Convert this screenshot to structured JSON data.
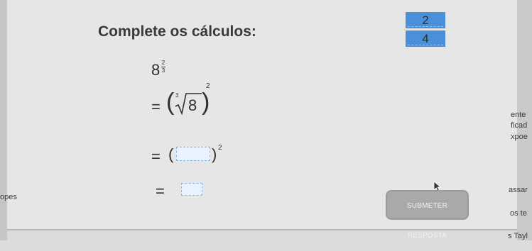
{
  "question": {
    "title": "Complete os cálculos:"
  },
  "answer_options": [
    "2",
    "4"
  ],
  "math": {
    "base": "8",
    "exp_num": "2",
    "exp_den": "3",
    "equals": "=",
    "radicand": "8",
    "root_index": "3",
    "outer_exponent": "2",
    "blank_exponent": "2"
  },
  "buttons": {
    "submit": "SUBMETER RESPOSTA"
  },
  "side_fragments": {
    "right": [
      "ente",
      "ficad",
      "xpoe",
      "assar",
      "os te",
      "s Tayl"
    ],
    "left": [
      "opes"
    ]
  },
  "colors": {
    "answer_tile": "#4a90d9",
    "drop_box": "#e9f3ff",
    "button": "#a9a9a9"
  }
}
